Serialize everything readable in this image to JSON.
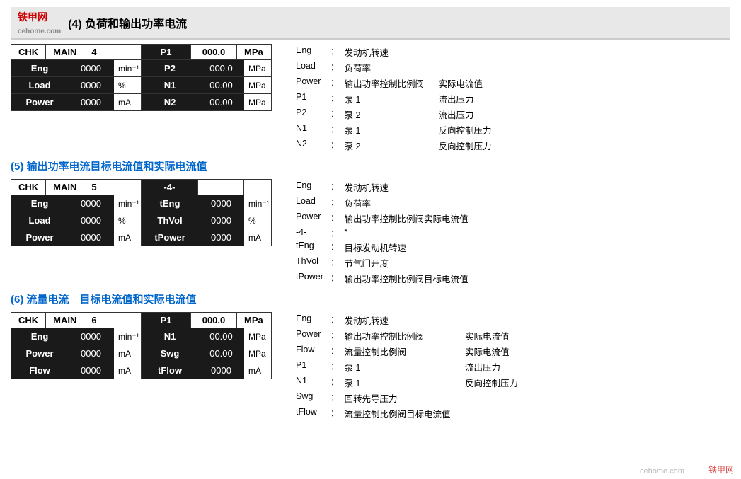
{
  "header": {
    "logo": "铁甲网",
    "sub": "cehome.com",
    "title": "(4) 负荷和输出功率电流"
  },
  "section4": {
    "title": "(4) 负荷和输出功率电流",
    "panel": {
      "chk": "CHK",
      "main": "MAIN",
      "num": "4",
      "rows_left": [
        {
          "label": "Eng",
          "value": "0000",
          "unit": "min⁻¹"
        },
        {
          "label": "Load",
          "value": "0000",
          "unit": "%"
        },
        {
          "label": "Power",
          "value": "0000",
          "unit": "mA"
        }
      ],
      "rows_right": [
        {
          "label": "P1",
          "value": "000.0",
          "unit": "MPa"
        },
        {
          "label": "P2",
          "value": "000.0",
          "unit": "MPa"
        },
        {
          "label": "N1",
          "value": "00.00",
          "unit": "MPa"
        },
        {
          "label": "N2",
          "value": "00.00",
          "unit": "MPa"
        }
      ]
    },
    "legend": [
      {
        "key": "Eng",
        "col2": "：发动机转速",
        "col3": ""
      },
      {
        "key": "Load",
        "col2": "：负荷率",
        "col3": ""
      },
      {
        "key": "Power",
        "col2": "：输出功率控制比例阀",
        "col3": "实际电流值"
      },
      {
        "key": "P1",
        "col2": "：泵 1",
        "col3": "流出压力"
      },
      {
        "key": "P2",
        "col2": "：泵 2",
        "col3": "流出压力"
      },
      {
        "key": "N1",
        "col2": "：泵 1",
        "col3": "反向控制压力"
      },
      {
        "key": "N2",
        "col2": "：泵 2",
        "col3": "反向控制压力"
      }
    ]
  },
  "section5": {
    "title": "(5) 输出功率电流目标电流值和实际电流值",
    "panel": {
      "chk": "CHK",
      "main": "MAIN",
      "num": "5",
      "right_header": "-4-",
      "rows_left": [
        {
          "label": "Eng",
          "value": "0000",
          "unit": "min⁻¹"
        },
        {
          "label": "Load",
          "value": "0000",
          "unit": "%"
        },
        {
          "label": "Power",
          "value": "0000",
          "unit": "mA"
        }
      ],
      "rows_right": [
        {
          "label": "tEng",
          "value": "0000",
          "unit": "min⁻¹"
        },
        {
          "label": "ThVol",
          "value": "0000",
          "unit": "%"
        },
        {
          "label": "tPower",
          "value": "0000",
          "unit": "mA"
        }
      ]
    },
    "legend": [
      {
        "key": "Eng",
        "col2": "：发动机转速",
        "col3": ""
      },
      {
        "key": "Load",
        "col2": "：负荷率",
        "col3": ""
      },
      {
        "key": "Power",
        "col2": "：输出功率控制比例阀实际电流值",
        "col3": ""
      },
      {
        "key": "-4-",
        "col2": "：*",
        "col3": ""
      },
      {
        "key": "tEng",
        "col2": "：目标发动机转速",
        "col3": ""
      },
      {
        "key": "ThVol",
        "col2": "：节气门开度",
        "col3": ""
      },
      {
        "key": "tPower",
        "col2": "：输出功率控制比例阀目标电流值",
        "col3": ""
      }
    ]
  },
  "section6": {
    "title": "(6) 流量电流　目标电流值和实际电流值",
    "panel": {
      "chk": "CHK",
      "main": "MAIN",
      "num": "6",
      "rows_left": [
        {
          "label": "Eng",
          "value": "0000",
          "unit": "min⁻¹"
        },
        {
          "label": "Power",
          "value": "0000",
          "unit": "mA"
        },
        {
          "label": "Flow",
          "value": "0000",
          "unit": "mA"
        }
      ],
      "rows_right": [
        {
          "label": "P1",
          "value": "000.0",
          "unit": "MPa"
        },
        {
          "label": "N1",
          "value": "00.00",
          "unit": "MPa"
        },
        {
          "label": "Swg",
          "value": "00.00",
          "unit": "MPa"
        },
        {
          "label": "tFlow",
          "value": "0000",
          "unit": "mA"
        }
      ]
    },
    "legend": [
      {
        "key": "Eng",
        "col2": "：发动机转速",
        "col3": ""
      },
      {
        "key": "Power",
        "col2": "：输出功率控制比例阀",
        "col3": "实际电流值"
      },
      {
        "key": "Flow",
        "col2": "：流量控制比例阀",
        "col3": "实际电流值"
      },
      {
        "key": "P1",
        "col2": "：泵 1",
        "col3": "流出压力"
      },
      {
        "key": "N1",
        "col2": "：泵 1",
        "col3": "反向控制压力"
      },
      {
        "key": "Swg",
        "col2": "：回转先导压力",
        "col3": ""
      },
      {
        "key": "tFlow",
        "col2": "：流量控制比例阀目标电流值",
        "col3": ""
      }
    ]
  },
  "watermark": "铁甲网",
  "watermark2": "cehome.com"
}
